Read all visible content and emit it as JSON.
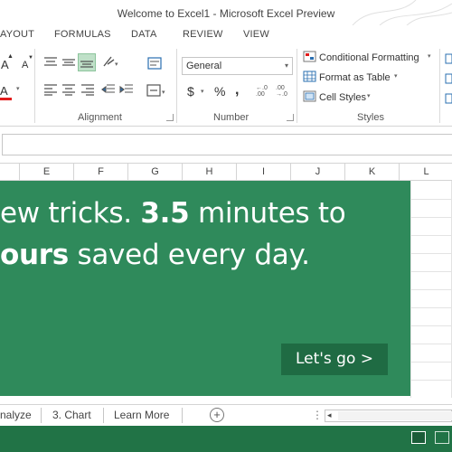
{
  "window": {
    "title": "Welcome to Excel1 - Microsoft Excel Preview"
  },
  "ribbon_tabs": [
    "AYOUT",
    "FORMULAS",
    "DATA",
    "REVIEW",
    "VIEW"
  ],
  "ribbon": {
    "font_sizes": {
      "grow": "A",
      "shrink": "A"
    },
    "font_color_glyph": "A",
    "alignment_label": "Alignment",
    "number_label": "Number",
    "number_format": "General",
    "currency": "$",
    "percent": "%",
    "comma": ",",
    "styles_label": "Styles",
    "conditional_formatting": "Conditional Formatting",
    "format_as_table": "Format as Table",
    "cell_styles": "Cell Styles"
  },
  "columns": [
    "E",
    "F",
    "G",
    "H",
    "I",
    "J",
    "K",
    "L"
  ],
  "banner": {
    "line1_pre": "ew tricks. ",
    "line1_bold": "3.5",
    "line1_post": " minutes to",
    "line2_bold": "ours",
    "line2_post": " saved every day.",
    "cta": "Let's go >"
  },
  "sheet_tabs": [
    "nalyze",
    "3. Chart",
    "Learn More"
  ],
  "add_sheet": "+",
  "scroll_dots": "⋮",
  "colors": {
    "brand_green": "#217346",
    "banner_green": "#2f8a5b",
    "cta_green": "#1f6b43"
  }
}
